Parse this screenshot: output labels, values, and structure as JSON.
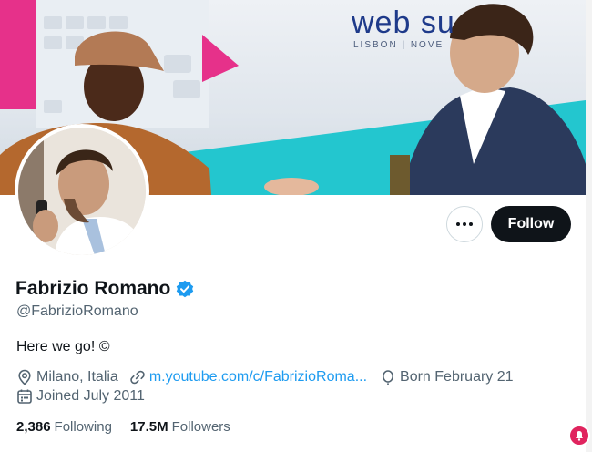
{
  "banner": {
    "sign_text": "web su",
    "sign_subtext": "LISBON | NOVE"
  },
  "profile": {
    "name": "Fabrizio Romano",
    "handle": "@FabrizioRomano",
    "bio": "Here we go! ©",
    "location": "Milano, Italia",
    "website": "m.youtube.com/c/FabrizioRoma...",
    "birthday": "Born February 21",
    "joined": "Joined July 2011",
    "following_count": "2,386",
    "following_label": "Following",
    "followers_count": "17.5M",
    "followers_label": "Followers"
  },
  "actions": {
    "follow_label": "Follow"
  },
  "colors": {
    "accent": "#1d9bf0",
    "button_dark": "#0f1419",
    "muted_text": "#536471",
    "notification": "#e0245e"
  },
  "icons": [
    "more-icon",
    "verified-badge-icon",
    "location-icon",
    "link-icon",
    "birthday-icon",
    "calendar-icon",
    "notification-icon"
  ]
}
